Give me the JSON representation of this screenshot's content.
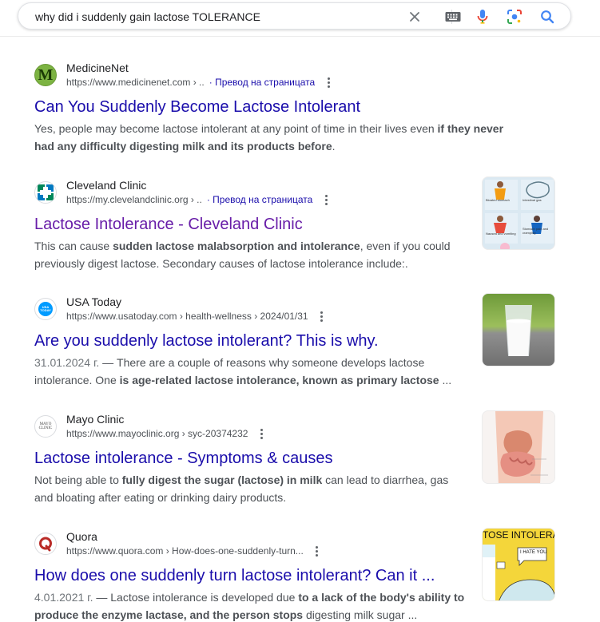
{
  "search": {
    "query": "why did i suddenly gain lactose TOLERANCE",
    "icons": [
      "close-icon",
      "keyboard-icon",
      "microphone-icon",
      "lens-icon",
      "search-icon"
    ]
  },
  "colors": {
    "link": "#1a0dab",
    "visited": "#681da8",
    "snippet": "#4d5156",
    "translate": "#1a0dab"
  },
  "results": [
    {
      "site": "MedicineNet",
      "url": "https://www.medicinenet.com › ..",
      "translate": "· Превод на страницата",
      "title": "Can You Suddenly Become Lactose Intolerant",
      "snippet_parts": [
        "Yes, people may become lactose intolerant at any point of time in their lives even ",
        "if they never had any difficulty digesting milk and its products before",
        "."
      ]
    },
    {
      "site": "Cleveland Clinic",
      "url": "https://my.clevelandclinic.org › ..",
      "translate": "· Превод на страницата",
      "title": "Lactose Intolerance - Cleveland Clinic",
      "snippet_parts": [
        "This can cause ",
        "sudden lactose malabsorption and intolerance",
        ", even if you could previously digest lactose. Secondary causes of lactose intolerance include:."
      ],
      "thumb_labels": [
        "Bloated stomach",
        "Intestinal gas",
        "Nausea and vomiting",
        "Stomach pain and cramping"
      ]
    },
    {
      "site": "USA Today",
      "favicon_text": "USA TODAY",
      "url": "https://www.usatoday.com › health-wellness › 2024/01/31",
      "title": "Are you suddenly lactose intolerant? This is why.",
      "date": "31.01.2024 г.",
      "snippet_parts": [
        " — There are a couple of reasons why someone develops lactose intolerance. One ",
        "is age-related lactose intolerance, known as primary lactose",
        " ..."
      ]
    },
    {
      "site": "Mayo Clinic",
      "favicon_text": "MAYO CLINIC",
      "url": "https://www.mayoclinic.org › syc-20374232",
      "title": "Lactose intolerance - Symptoms & causes",
      "snippet_parts": [
        "Not being able to ",
        "fully digest the sugar (lactose) in milk",
        " can lead to diarrhea, gas and bloating after eating or drinking dairy products."
      ]
    },
    {
      "site": "Quora",
      "url": "https://www.quora.com › How-does-one-suddenly-turn...",
      "title": "How does one suddenly turn lactose intolerant? Can it ...",
      "date": "4.01.2021 г.",
      "snippet_parts": [
        " — Lactose intolerance is developed due ",
        "to a lack of the body's ability to produce the enzyme lactase, and the person stops",
        " digesting milk sugar ..."
      ],
      "thumb_text": "TOSE INTOLERANC",
      "thumb_bubble": "I HATE YOU"
    }
  ]
}
